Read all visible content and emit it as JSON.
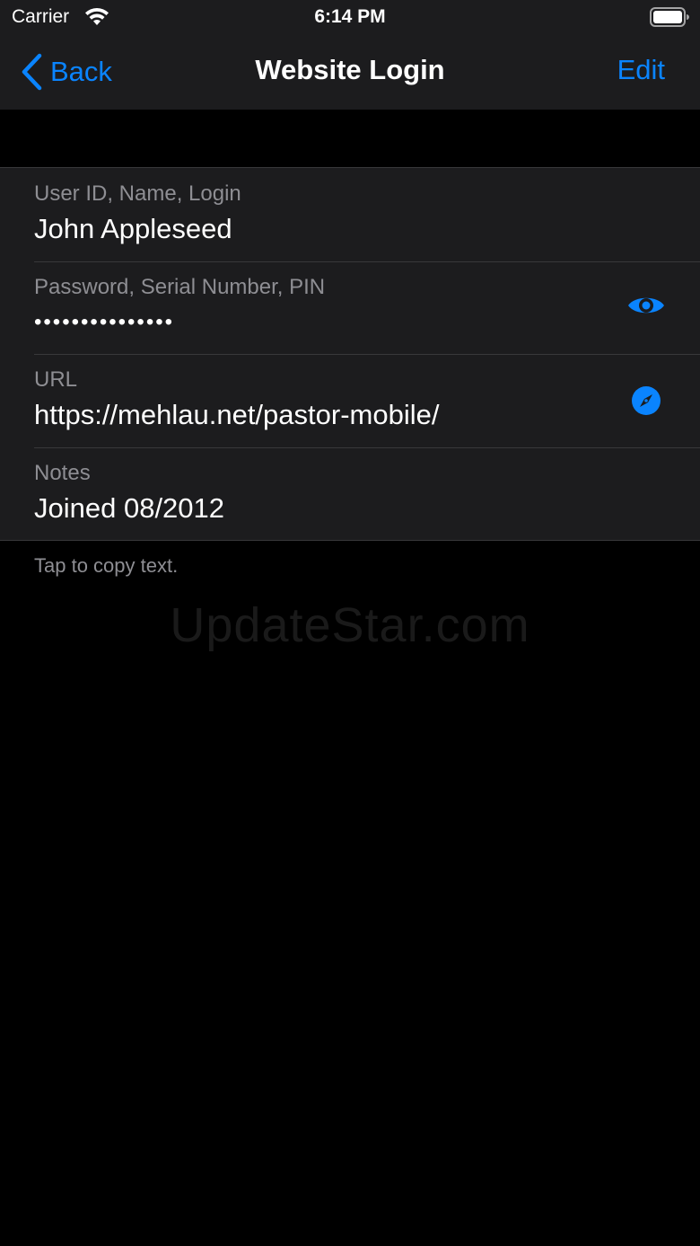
{
  "status_bar": {
    "carrier": "Carrier",
    "time": "6:14 PM",
    "wifi_icon": "wifi-icon",
    "battery_icon": "battery-icon"
  },
  "nav": {
    "back_label": "Back",
    "title": "Website Login",
    "edit_label": "Edit",
    "accent_color": "#0a84ff"
  },
  "fields": {
    "user": {
      "label": "User ID, Name, Login",
      "value": "John Appleseed"
    },
    "password": {
      "label": "Password, Serial Number, PIN",
      "value": "•••••••••••••••",
      "icon": "eye-icon"
    },
    "url": {
      "label": "URL",
      "value": "https://mehlau.net/pastor-mobile/",
      "icon": "compass-icon"
    },
    "notes": {
      "label": "Notes",
      "value": "Joined 08/2012"
    }
  },
  "footer_note": "Tap to copy text.",
  "watermark": "UpdateStar.com"
}
